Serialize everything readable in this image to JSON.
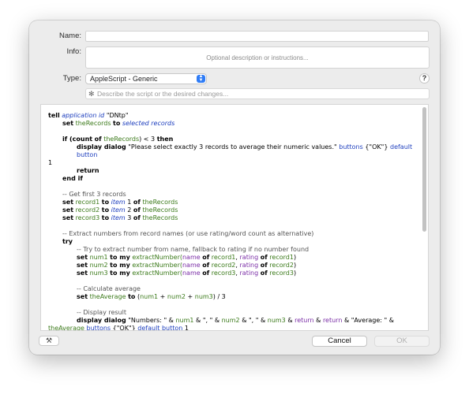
{
  "form": {
    "name_label": "Name:",
    "name_value": "",
    "info_label": "Info:",
    "info_placeholder": "Optional description or instructions...",
    "type_label": "Type:",
    "type_value": "AppleScript - Generic",
    "help_label": "?",
    "ai_placeholder": "Describe the script or the desired changes...",
    "sparkle_glyph": "✻"
  },
  "code": {
    "l1a": "tell",
    "l1b": "application id",
    "l1c": "\"DNtp\"",
    "l2a": "set",
    "l2b": "theRecords",
    "l2c": "to",
    "l2d": "selected records",
    "l4a": "if (",
    "l4b": "count",
    "l4c": "of",
    "l4d": "theRecords",
    "l4e": ") < 3",
    "l4f": "then",
    "l5a": "display dialog",
    "l5b": "\"Please select exactly 3 records to average their numeric values.\"",
    "l5c": "buttons",
    "l5d": "{\"OK\"}",
    "l5e": "default button",
    "l5f": "1",
    "l6": "return",
    "l7": "end if",
    "c1": "-- Get first 3 records",
    "r1a": "set",
    "r1b": "record1",
    "r1c": "to",
    "r1d": "item",
    "r1e": "1",
    "r1f": "of",
    "r1g": "theRecords",
    "r2b": "record2",
    "r2e": "2",
    "r3b": "record3",
    "r3e": "3",
    "c2": "-- Extract numbers from record names (or use rating/word count as alternative)",
    "try": "try",
    "c3": "-- Try to extract number from name, fallback to rating if no number found",
    "n1a": "set",
    "n1b": "num1",
    "n1c": "to my",
    "n1d": "extractNumber(",
    "n1e": "name",
    "n1f": "of",
    "n1g": "record1",
    "n1h": ",",
    "n1i": "rating",
    "n1j": "of",
    "n1k": "record1",
    "n1l": ")",
    "n2b": "num2",
    "n2g": "record2",
    "n2k": "record2",
    "n3b": "num3",
    "n3g": "record3",
    "n3k": "record3",
    "c4": "-- Calculate average",
    "avg_a": "set",
    "avg_b": "theAverage",
    "avg_c": "to",
    "avg_d": "(",
    "avg_e": "num1",
    "avg_f": "+",
    "avg_g": "num2",
    "avg_h": "+",
    "avg_i": "num3",
    "avg_j": ") / 3",
    "c5": "-- Display result",
    "d1": "display dialog",
    "d2": "\"Numbers: \" &",
    "d3": "num1",
    "d4": "& \", \" &",
    "d5": "num2",
    "d6": "& \", \" &",
    "d7": "num3",
    "d8": "&",
    "d9": "return",
    "d10": "&",
    "d11": "return",
    "d12": "& \"Average: \" &",
    "d13": "theAverage",
    "d14": "buttons",
    "d15": "{\"OK\"}",
    "d16": "default button",
    "d17": "1"
  },
  "footer": {
    "cancel_label": "Cancel",
    "ok_label": "OK"
  }
}
